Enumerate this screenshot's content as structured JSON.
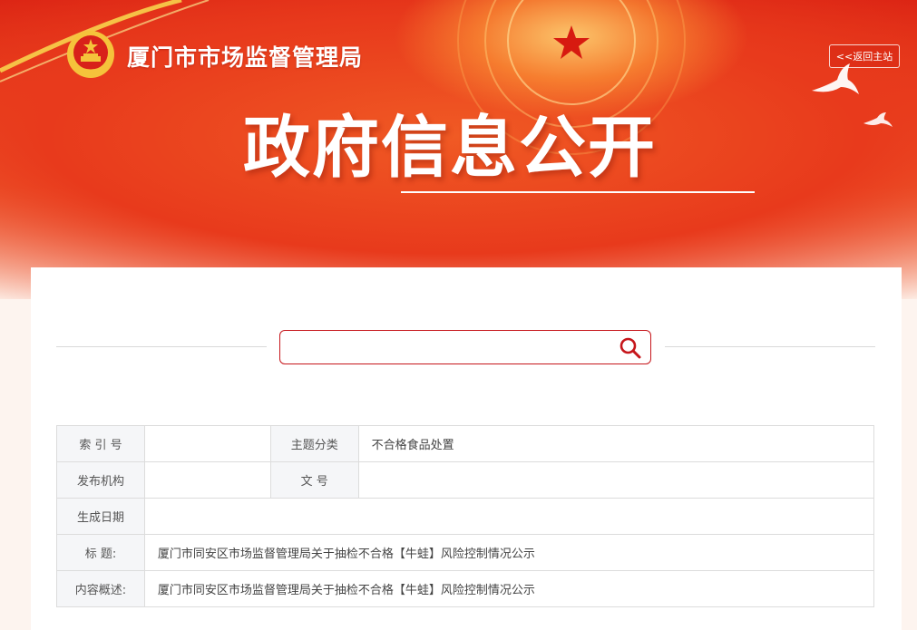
{
  "header": {
    "site_title": "厦门市市场监督管理局",
    "return_button": "<<返回主站",
    "page_title": "政府信息公开"
  },
  "search": {
    "value": "",
    "placeholder": ""
  },
  "info_table": {
    "index_label": "索 引 号",
    "index_value": "",
    "topic_label": "主题分类",
    "topic_value": "不合格食品处置",
    "publisher_label": "发布机构",
    "publisher_value": "",
    "docno_label": "文 号",
    "docno_value": "",
    "date_label": "生成日期",
    "date_value": "",
    "title_label": "标 题:",
    "title_value": "厦门市同安区市场监督管理局关于抽检不合格【牛蛙】风险控制情况公示",
    "summary_label": "内容概述:",
    "summary_value": "厦门市同安区市场监督管理局关于抽检不合格【牛蛙】风险控制情况公示"
  },
  "colors": {
    "accent_red": "#c6161b",
    "banner_red": "#e23a1c"
  }
}
